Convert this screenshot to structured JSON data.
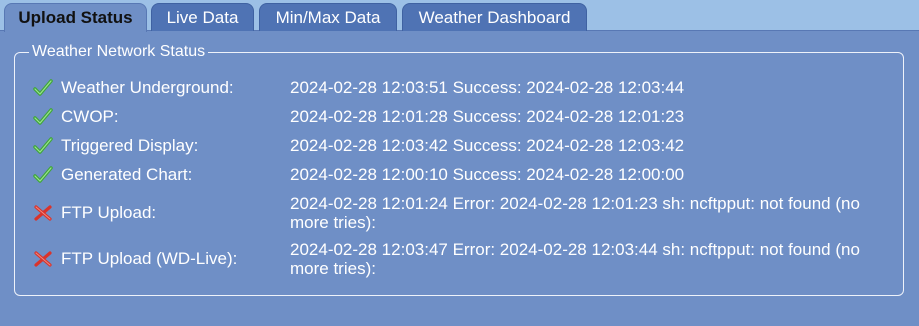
{
  "tabs": [
    {
      "label": "Upload Status",
      "active": true
    },
    {
      "label": "Live Data",
      "active": false
    },
    {
      "label": "Min/Max Data",
      "active": false
    },
    {
      "label": "Weather Dashboard",
      "active": false
    }
  ],
  "panel": {
    "legend": "Weather Network Status",
    "rows": [
      {
        "name": "Weather Underground:",
        "status": "2024-02-28 12:03:51 Success: 2024-02-28 12:03:44",
        "icon": "check-icon"
      },
      {
        "name": "CWOP:",
        "status": "2024-02-28 12:01:28 Success: 2024-02-28 12:01:23",
        "icon": "check-icon"
      },
      {
        "name": "Triggered Display:",
        "status": "2024-02-28 12:03:42 Success: 2024-02-28 12:03:42",
        "icon": "check-icon"
      },
      {
        "name": "Generated Chart:",
        "status": "2024-02-28 12:00:10 Success: 2024-02-28 12:00:00",
        "icon": "check-icon"
      },
      {
        "name": "FTP Upload:",
        "status": "2024-02-28 12:01:24 Error: 2024-02-28 12:01:23 sh: ncftpput: not found (no more tries):",
        "icon": "cross-icon"
      },
      {
        "name": "FTP Upload (WD-Live):",
        "status": "2024-02-28 12:03:47 Error: 2024-02-28 12:03:44 sh: ncftpput: not found (no more tries):",
        "icon": "cross-icon"
      }
    ]
  },
  "colors": {
    "background": "#6f8fc6",
    "tab_bar": "#9cc0e6",
    "tab_inactive": "#4f73b4",
    "success": "#3fa63a",
    "error": "#d9332b"
  }
}
